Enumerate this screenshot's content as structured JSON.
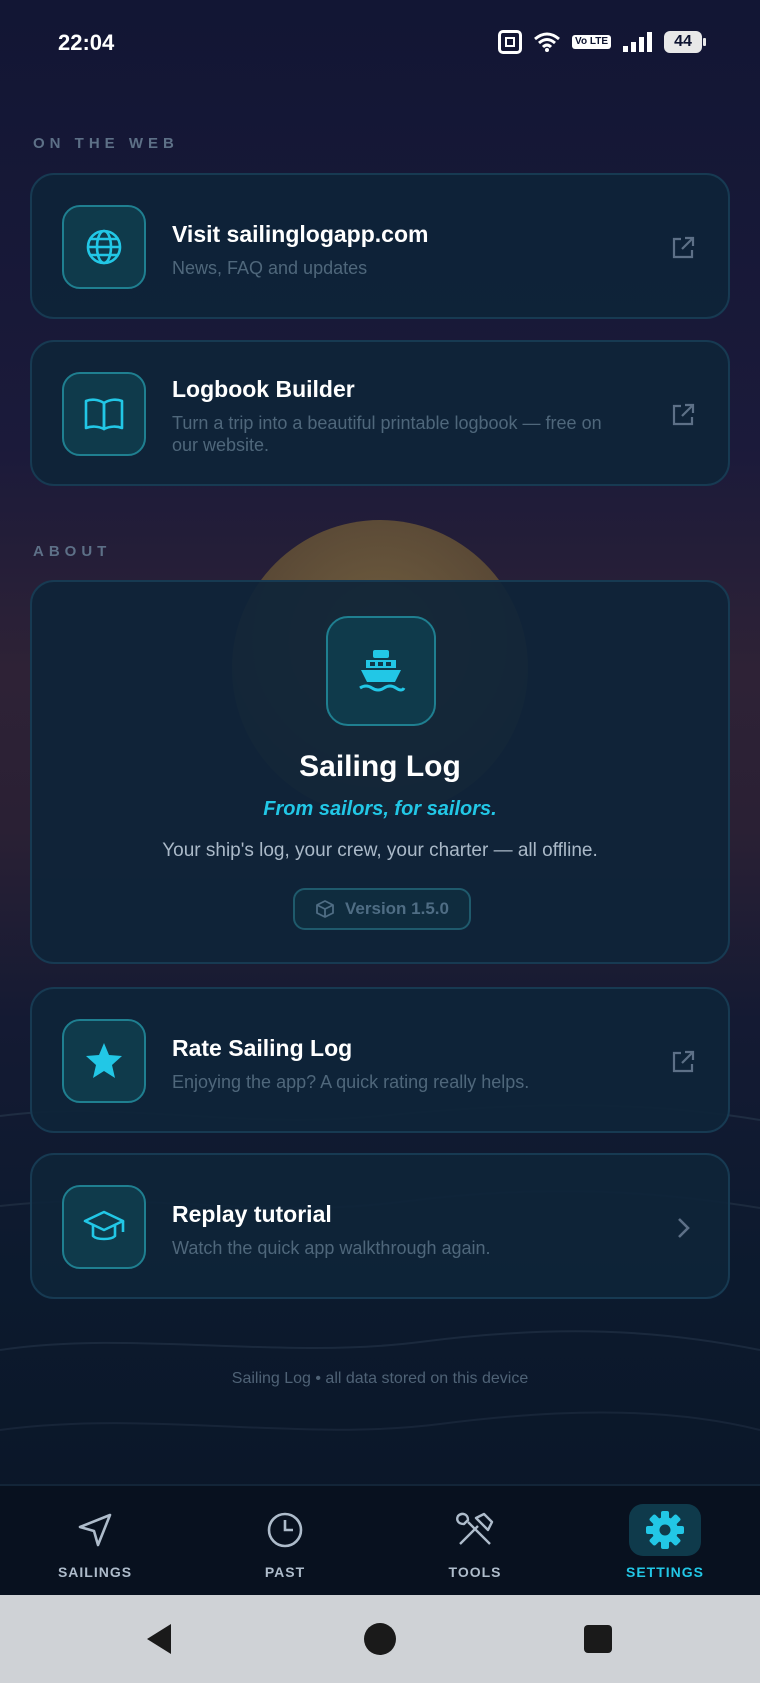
{
  "status_bar": {
    "time": "22:04",
    "volte": "Vo LTE",
    "battery": "44"
  },
  "sections": {
    "web_label": "ON THE WEB",
    "about_label": "ABOUT"
  },
  "web_items": [
    {
      "title": "Visit sailinglogapp.com",
      "subtitle": "News, FAQ and updates",
      "icon": "globe-icon",
      "trailing": "external-link-icon"
    },
    {
      "title": "Logbook Builder",
      "subtitle": "Turn a trip into a beautiful printable logbook — free on our website.",
      "icon": "book-icon",
      "trailing": "external-link-icon"
    }
  ],
  "about": {
    "app_icon": "ship-icon",
    "app_name": "Sailing Log",
    "tagline": "From sailors, for sailors.",
    "description": "Your ship's log, your crew, your charter — all offline.",
    "version": "Version 1.5.0",
    "version_icon": "cube-icon"
  },
  "more_items": [
    {
      "title": "Rate Sailing Log",
      "subtitle": "Enjoying the app? A quick rating really helps.",
      "icon": "star-icon",
      "trailing": "external-link-icon"
    },
    {
      "title": "Replay tutorial",
      "subtitle": "Watch the quick app walkthrough again.",
      "icon": "graduation-cap-icon",
      "trailing": "chevron-right-icon"
    }
  ],
  "footer": "Sailing Log • all data stored on this device",
  "bottom_nav": [
    {
      "label": "SAILINGS",
      "icon": "navigation-arrow-icon",
      "active": false
    },
    {
      "label": "PAST",
      "icon": "clock-icon",
      "active": false
    },
    {
      "label": "TOOLS",
      "icon": "tools-icon",
      "active": false
    },
    {
      "label": "SETTINGS",
      "icon": "gear-icon",
      "active": true
    }
  ],
  "colors": {
    "accent": "#22c7e6",
    "card_bg": "#0e2438",
    "muted_text": "#4f677b"
  }
}
